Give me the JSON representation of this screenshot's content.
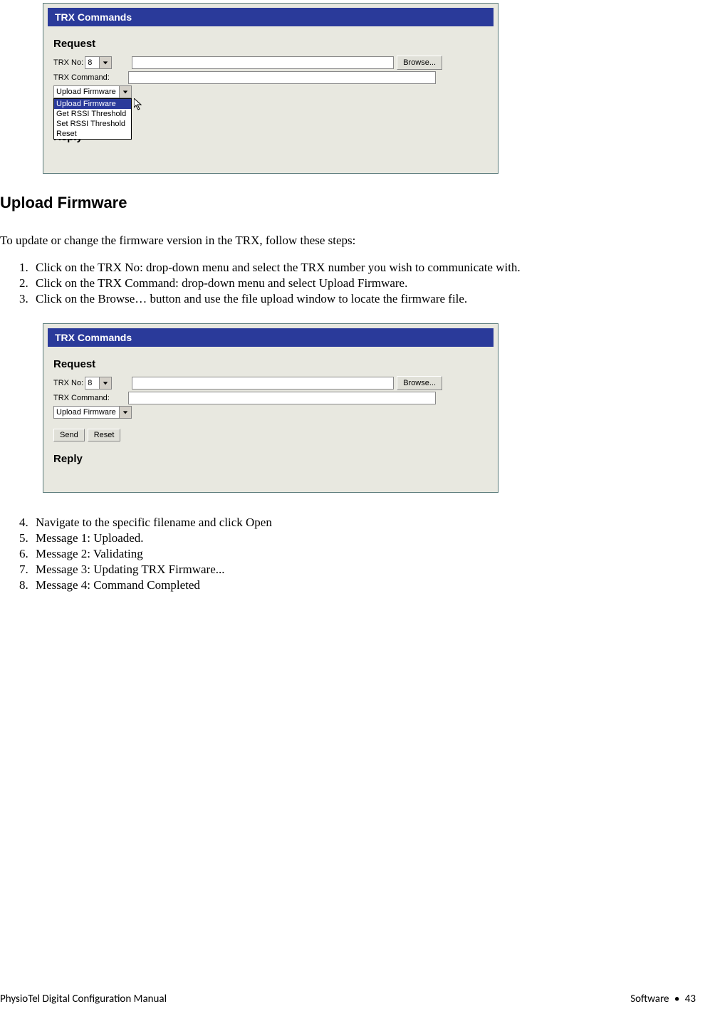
{
  "screenshot1": {
    "header": "TRX Commands",
    "request_label": "Request",
    "reply_label": "Reply",
    "trx_no_label": "TRX No:",
    "trx_no_value": "8",
    "trx_command_label": "TRX Command:",
    "browse_button": "Browse...",
    "dropdown": {
      "selected": "Upload Firmware",
      "options": [
        "Upload Firmware",
        "Get RSSI Threshold",
        "Set RSSI Threshold",
        "Reset"
      ]
    }
  },
  "heading": "Upload Firmware",
  "intro": "To update or change the firmware version in the TRX, follow these steps:",
  "steps_a": [
    "Click on the TRX No:  drop-down menu and select the TRX number you wish to communicate with.",
    "Click on the TRX Command:  drop-down menu and select Upload Firmware.",
    "Click on the Browse… button and use the file upload window to locate the firmware file."
  ],
  "screenshot2": {
    "header": "TRX Commands",
    "request_label": "Request",
    "reply_label": "Reply",
    "trx_no_label": "TRX No:",
    "trx_no_value": "8",
    "trx_command_label": "TRX Command:",
    "trx_command_value": "Upload Firmware",
    "browse_button": "Browse...",
    "send_button": "Send",
    "reset_button": "Reset"
  },
  "steps_b": [
    "Navigate to the specific filename and click Open",
    "Message 1: Uploaded.",
    "Message 2: Validating",
    "Message 3: Updating TRX Firmware...",
    "Message 4: Command Completed"
  ],
  "footer": {
    "left": "PhysioTel Digital Configuration Manual",
    "right_section": "Software",
    "right_bullet": "•",
    "right_page": "43"
  }
}
